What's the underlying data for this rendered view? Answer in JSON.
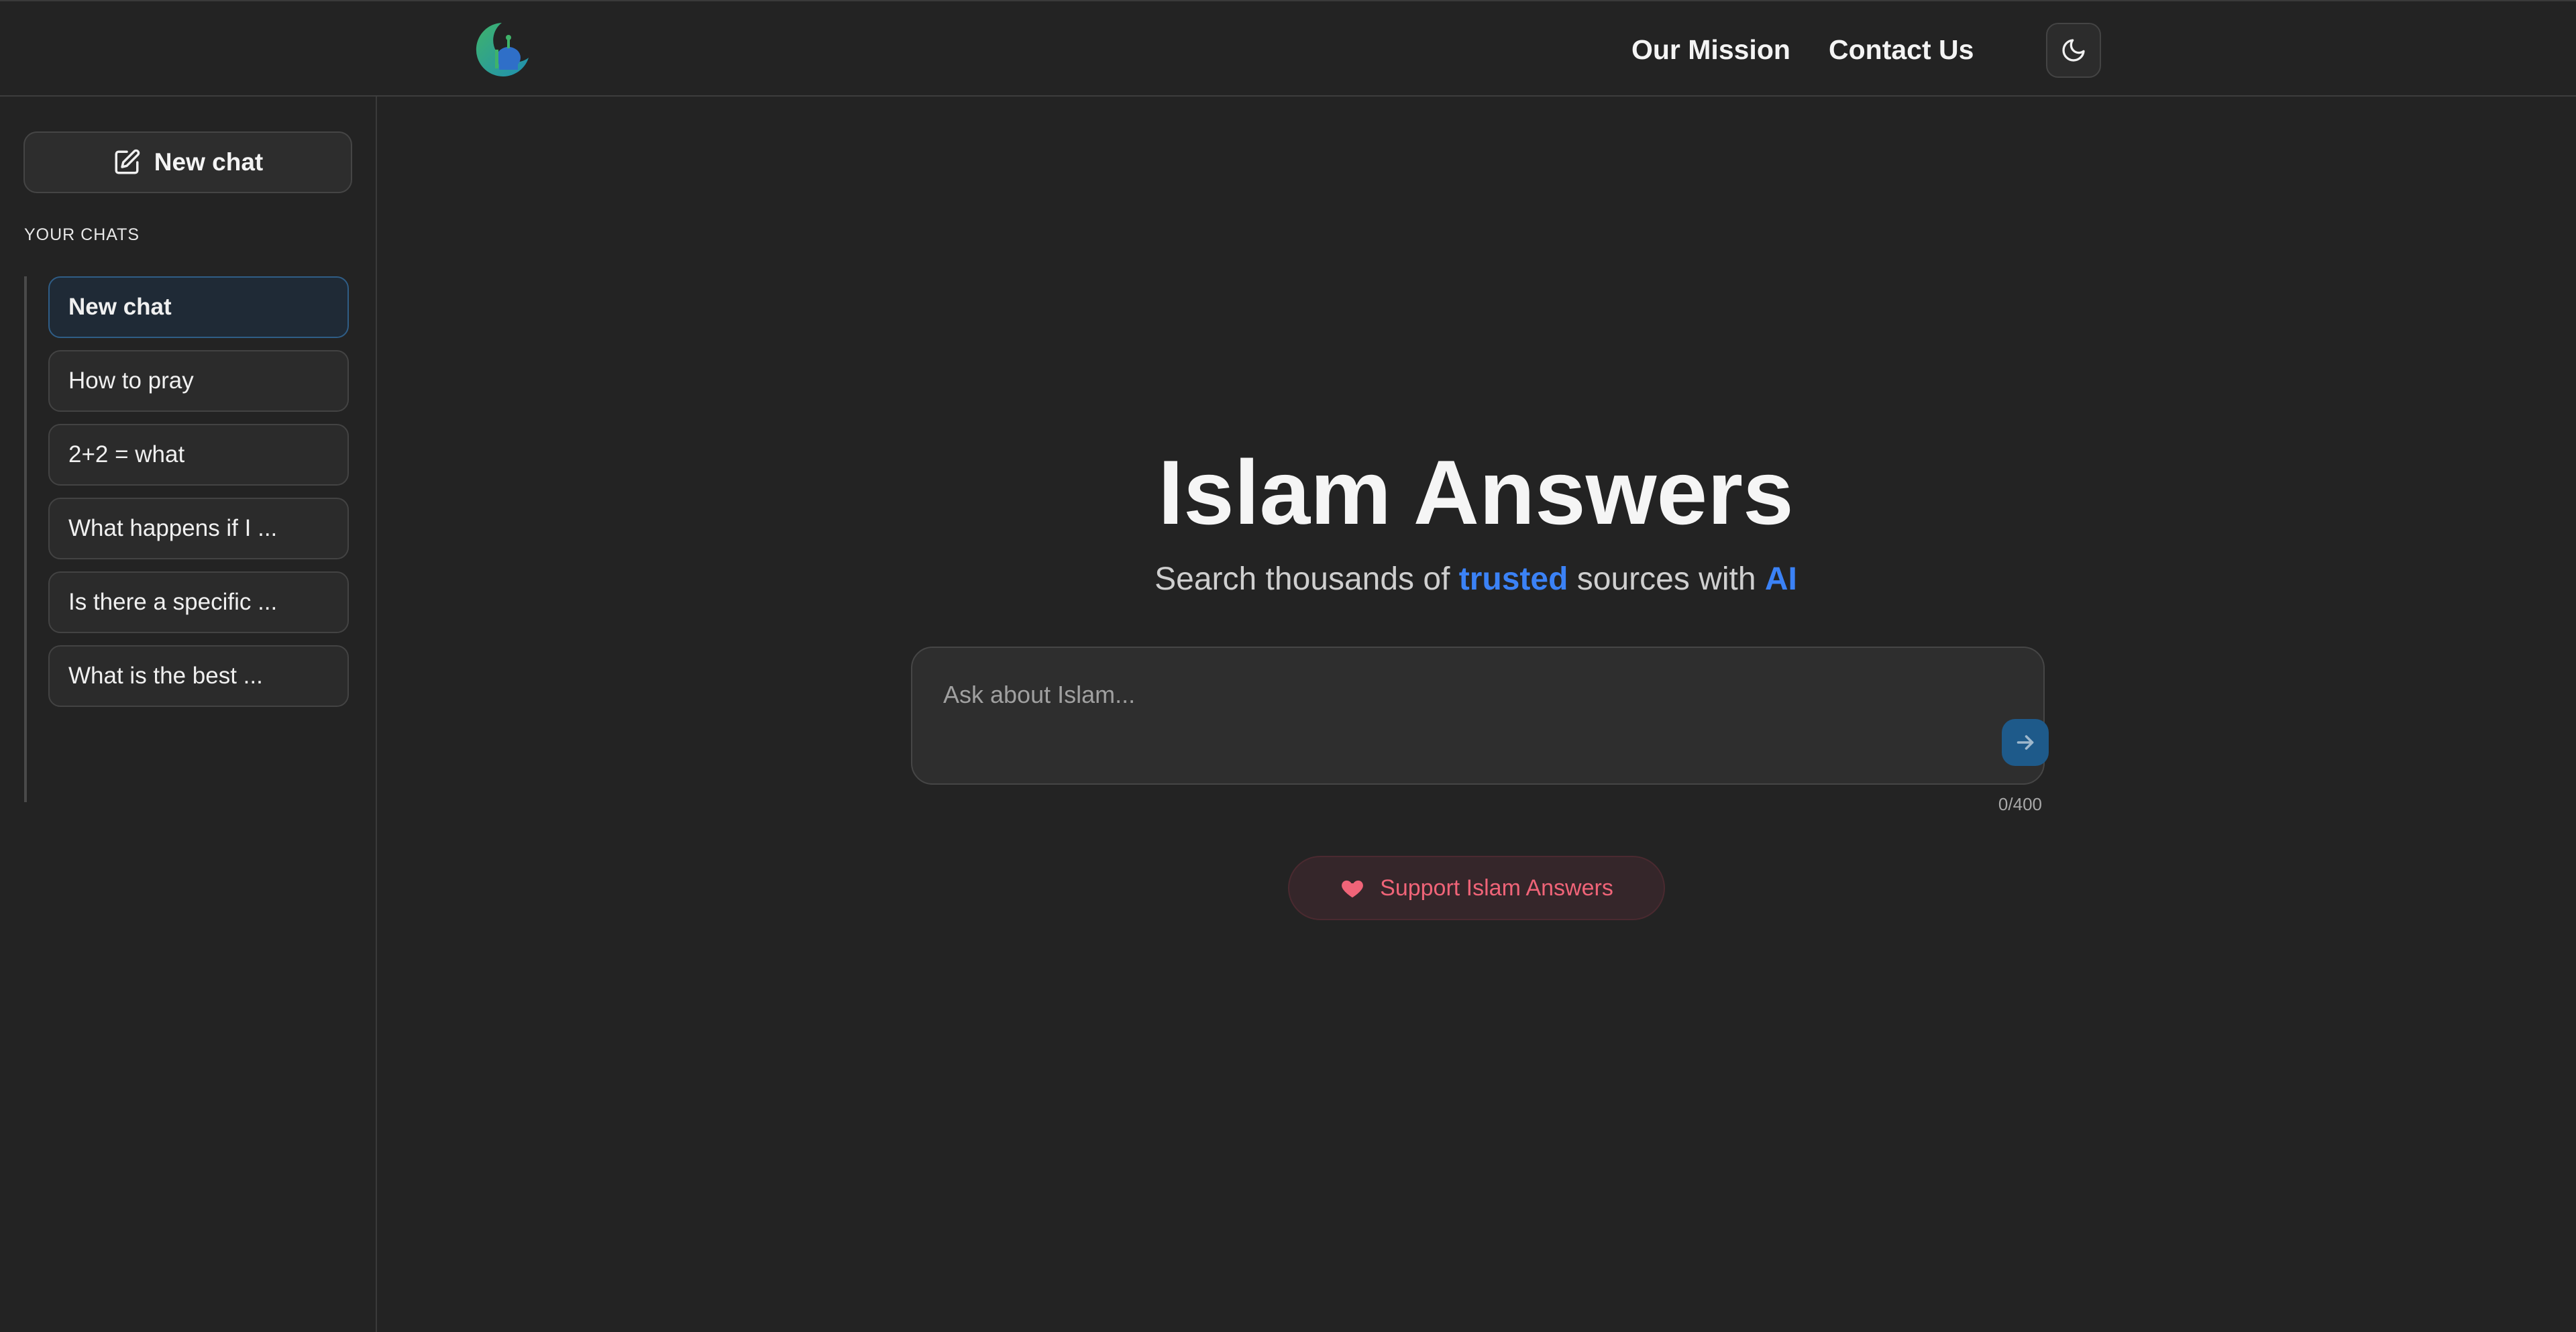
{
  "header": {
    "nav": {
      "mission_label": "Our Mission",
      "contact_label": "Contact Us"
    },
    "theme_icon": "moon-icon"
  },
  "sidebar": {
    "new_chat_label": "New chat",
    "new_chat_icon": "edit-icon",
    "section_title": "YOUR CHATS",
    "chats": [
      {
        "label": "New chat",
        "active": true
      },
      {
        "label": "How to pray",
        "active": false
      },
      {
        "label": "2+2 = what",
        "active": false
      },
      {
        "label": "What happens if I ...",
        "active": false
      },
      {
        "label": "Is there a specific ...",
        "active": false
      },
      {
        "label": "What is the best ...",
        "active": false
      }
    ]
  },
  "main": {
    "title": "Islam Answers",
    "subtitle": {
      "part1": "Search thousands of ",
      "highlight1": "trusted",
      "part2": " sources with ",
      "highlight2": "AI"
    },
    "search": {
      "placeholder": "Ask about Islam...",
      "value": "",
      "char_count": "0/400",
      "send_icon": "arrow-right-icon"
    },
    "support": {
      "label": "Support Islam Answers",
      "icon": "heart-icon"
    }
  },
  "colors": {
    "background": "#232323",
    "accent_blue": "#3b82f6",
    "support_pink": "#f06478",
    "send_button": "#1e5a8a"
  }
}
